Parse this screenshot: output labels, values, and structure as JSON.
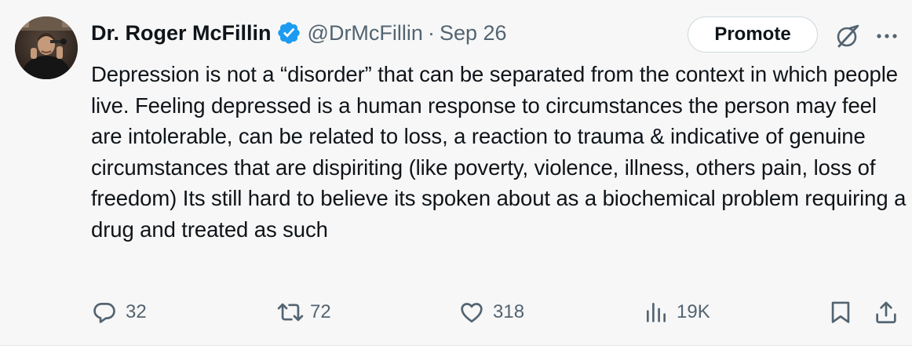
{
  "author": {
    "display_name": "Dr. Roger McFillin",
    "handle": "@DrMcFillin",
    "separator": "·",
    "date": "Sep 26",
    "verified": true,
    "verified_color": "#1d9bf0"
  },
  "header_actions": {
    "promote_label": "Promote",
    "grok_icon": "grok-icon",
    "more_icon": "more-icon"
  },
  "tweet": {
    "text": "Depression is not a “disorder” that can be separated from the context in which people live. Feeling depressed is a human response to circumstances the person may feel are intolerable, can be related to loss, a reaction to trauma & indicative of genuine circumstances that are dispiriting (like poverty, violence, illness, others pain, loss of freedom)  Its still hard to believe its spoken about as a biochemical problem requiring a drug and treated as such"
  },
  "actions": {
    "replies": "32",
    "reposts": "72",
    "likes": "318",
    "views": "19K"
  },
  "colors": {
    "text": "#0f1419",
    "secondary": "#536471",
    "background": "#f7f7f7"
  }
}
